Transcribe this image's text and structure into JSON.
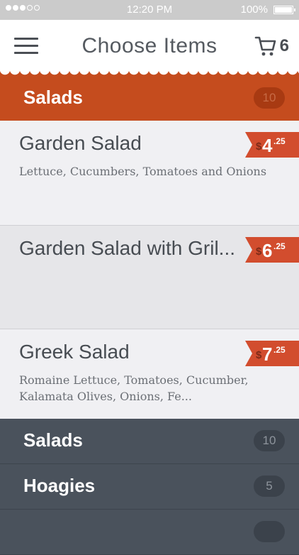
{
  "status_bar": {
    "time": "12:20 PM",
    "battery": "100%",
    "signal_dots_filled": 3,
    "signal_dots_total": 5
  },
  "header": {
    "title": "Choose Items",
    "cart_count": "6",
    "menu_icon": "hamburger-menu-icon",
    "cart_icon": "shopping-cart-icon"
  },
  "section": {
    "title": "Salads",
    "count": "10"
  },
  "items": [
    {
      "name": "Garden Salad",
      "description": "Lettuce, Cucumbers, Tomatoes and Onions",
      "price_symbol": "$",
      "price_dollars": "4",
      "price_cents": ".25"
    },
    {
      "name": "Garden Salad with Gril...",
      "description": "",
      "price_symbol": "$",
      "price_dollars": "6",
      "price_cents": ".25"
    },
    {
      "name": "Greek Salad",
      "description": "Romaine Lettuce, Tomatoes, Cucumber, Kalamata Olives, Onions, Fe...",
      "price_symbol": "$",
      "price_dollars": "7",
      "price_cents": ".25"
    }
  ],
  "categories": [
    {
      "label": "Salads",
      "count": "10"
    },
    {
      "label": "Hoagies",
      "count": "5"
    }
  ],
  "colors": {
    "accent": "#c54c1e",
    "price_tag": "#d24d2e",
    "category_bg": "#4a525c",
    "title_text": "#555a60"
  }
}
